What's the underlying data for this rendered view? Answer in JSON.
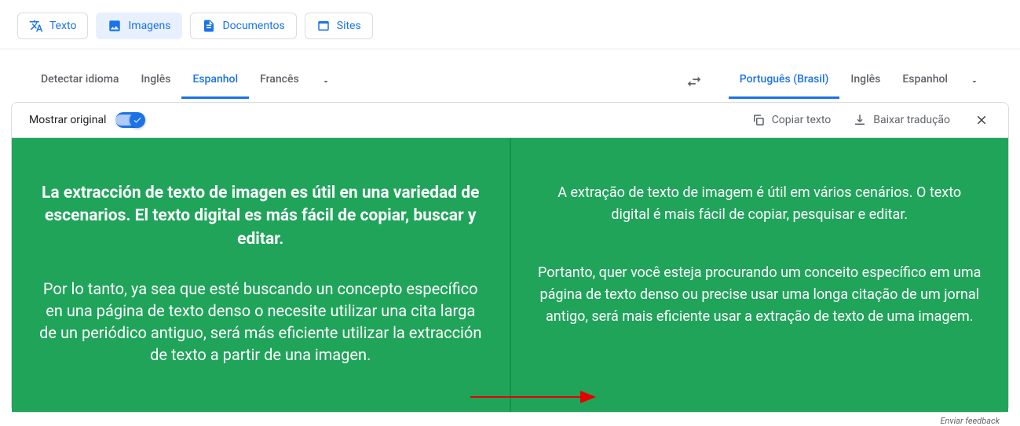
{
  "tabs": {
    "text": "Texto",
    "images": "Imagens",
    "documents": "Documentos",
    "sites": "Sites"
  },
  "sourceLang": {
    "detect": "Detectar idioma",
    "english": "Inglês",
    "spanish": "Espanhol",
    "french": "Francês"
  },
  "targetLang": {
    "portuguese": "Português (Brasil)",
    "english": "Inglês",
    "spanish": "Espanhol"
  },
  "toolbar": {
    "showOriginal": "Mostrar original",
    "copyText": "Copiar texto",
    "downloadTranslation": "Baixar tradução"
  },
  "source": {
    "p1": "La extracción de texto de imagen es útil en una variedad de escenarios. El texto digital es más fácil de copiar, buscar y editar.",
    "p2": "Por lo tanto, ya sea que esté buscando un concepto específico en una página de texto denso o necesite utilizar una cita larga de un periódico antiguo, será más eficiente utilizar la extracción de texto a partir de una imagen."
  },
  "translation": {
    "p1": "A extração de texto de imagem é útil em vários cenários. O texto digital é mais fácil de copiar, pesquisar e editar.",
    "p2": "Portanto, quer você esteja procurando um conceito específico em uma página de texto denso ou precise usar uma longa citação de um jornal antigo, será mais eficiente usar a extração de texto de uma imagem."
  },
  "feedback": "Enviar feedback"
}
